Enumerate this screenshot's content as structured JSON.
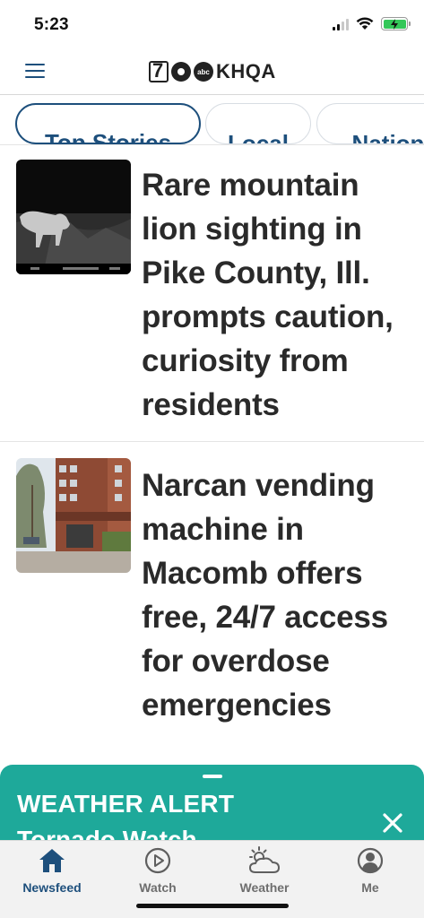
{
  "status_bar": {
    "time": "5:23"
  },
  "header": {
    "logo_text": "KHQA",
    "logo_abc": "abc",
    "menu_icon": "hamburger-menu-icon"
  },
  "tabs": [
    {
      "label": "Top Stories",
      "active": true
    },
    {
      "label": "Local",
      "active": false
    },
    {
      "label": "Nation",
      "active": false
    }
  ],
  "articles": [
    {
      "headline": "Rare mountain lion sighting in Pike County, Ill. prompts caution, curiosity from residents",
      "thumbnail": "trail-camera-mountain-lion-photo"
    },
    {
      "headline": "Narcan vending machine in Macomb offers free, 24/7 access for overdose emergencies",
      "thumbnail": "brick-apartment-building-photo"
    }
  ],
  "weather_alert": {
    "title": "WEATHER ALERT",
    "subtitle": "Tornado Watch",
    "color": "#1ea99a"
  },
  "bottom_nav": [
    {
      "label": "Newsfeed",
      "icon": "house-icon",
      "active": true
    },
    {
      "label": "Watch",
      "icon": "play-circle-icon",
      "active": false
    },
    {
      "label": "Weather",
      "icon": "partly-cloudy-icon",
      "active": false
    },
    {
      "label": "Me",
      "icon": "user-circle-icon",
      "active": false
    }
  ],
  "colors": {
    "accent": "#1d4f7c",
    "alert": "#1ea99a",
    "battery": "#34c759"
  }
}
